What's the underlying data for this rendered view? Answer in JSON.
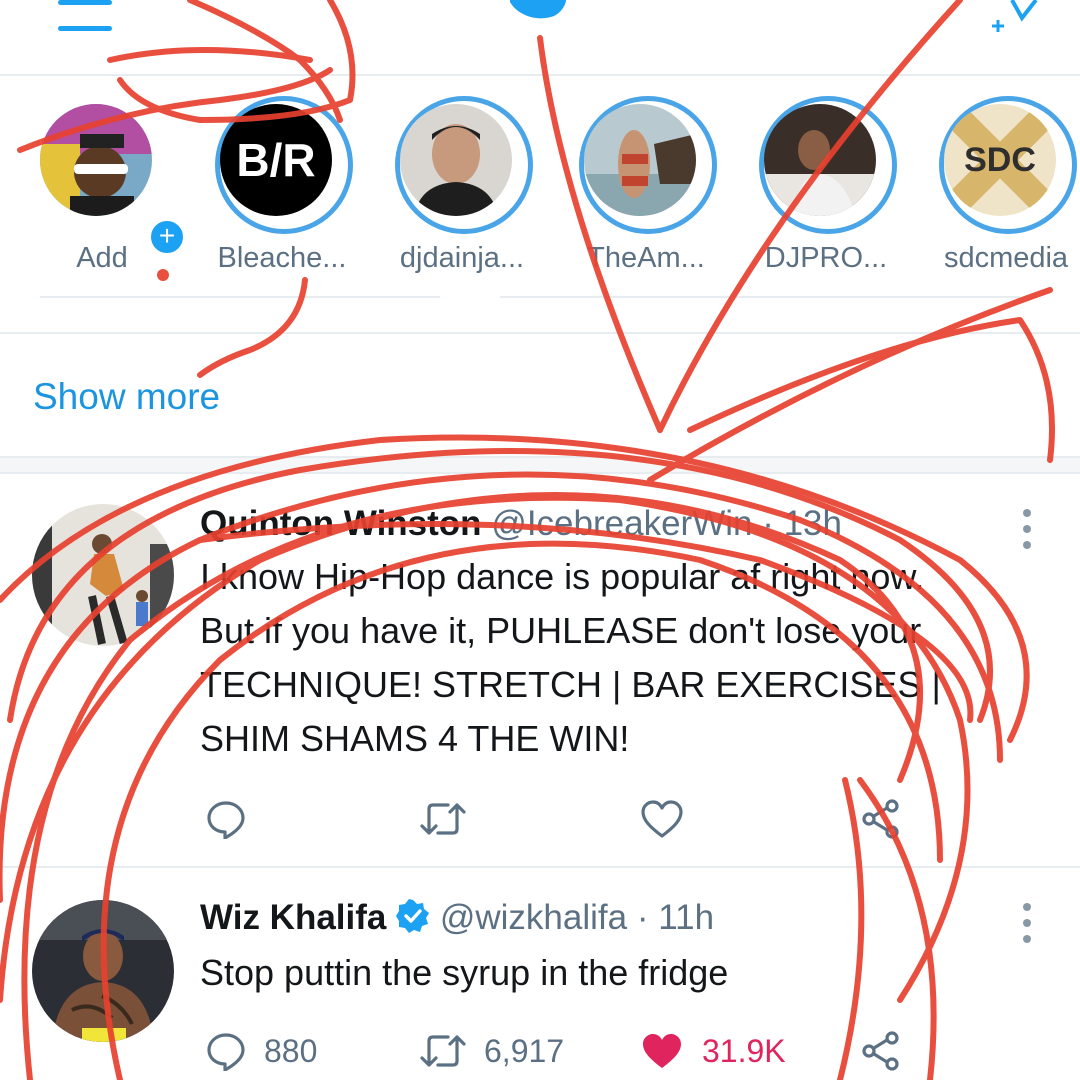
{
  "top_bar": {
    "menu_icon": "hamburger-menu-icon",
    "logo_icon": "twitter-bird-icon",
    "sparkle_icon": "sparkle-timeline-icon",
    "accent": "#1da1f2"
  },
  "stories": [
    {
      "label": "Add",
      "has_ring": false,
      "badge": "+"
    },
    {
      "label": "Bleache...",
      "has_ring": true,
      "logo_text": "B/R"
    },
    {
      "label": "djdainja...",
      "has_ring": true
    },
    {
      "label": "TheAm...",
      "has_ring": true
    },
    {
      "label": "DJPRO...",
      "has_ring": true
    },
    {
      "label": "sdcmedia",
      "has_ring": true,
      "logo_text": "SDC"
    }
  ],
  "show_more": "Show more",
  "tweets": [
    {
      "author": "Quinton Winston",
      "handle": "@IcebreakerWin",
      "dot": "·",
      "time": "13h",
      "text_lines": [
        "I know Hip-Hop dance is popular af right now.",
        "But if you have it, PUHLEASE don't lose your",
        "TECHNIQUE! STRETCH | BAR EXERCISES |",
        "SHIM SHAMS 4 THE WIN!"
      ],
      "verified": false
    },
    {
      "author": "Wiz Khalifa",
      "handle": "@wizkhalifa",
      "dot": "·",
      "time": "11h",
      "text_lines": [
        "Stop puttin the syrup in the fridge"
      ],
      "verified": true,
      "replies": "880",
      "retweets": "6,917",
      "likes": "31.9K",
      "liked": true
    }
  ],
  "colors": {
    "accent": "#1da1f2",
    "secondary_text": "#5b7083",
    "like": "#e0245e",
    "annotation": "#e8412f"
  }
}
